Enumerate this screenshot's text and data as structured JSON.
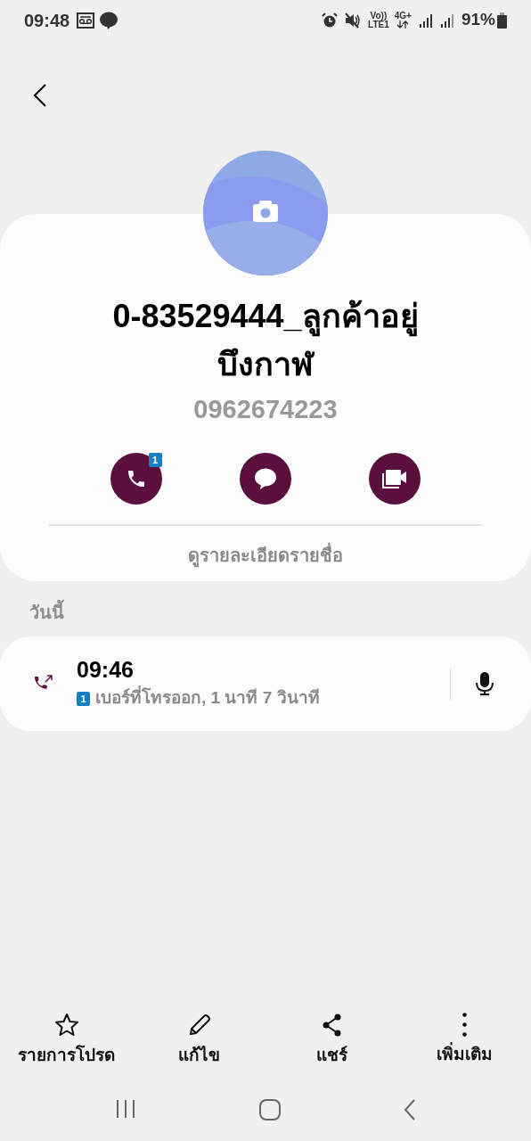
{
  "status_bar": {
    "time": "09:48",
    "volte_top": "Vo))",
    "volte_bottom": "LTE1",
    "network": "4G+",
    "battery": "91%"
  },
  "contact": {
    "name": "0-83529444_ลูกค้าอยู่\nบึงกาฬ",
    "number": "0962674223",
    "call_badge": "1",
    "details_link": "ดูรายละเอียดรายชื่อ"
  },
  "history": {
    "heading": "วันนี้",
    "entries": [
      {
        "time": "09:46",
        "sim": "1",
        "description": "เบอร์ที่โทรออก, 1 นาที 7 วินาที"
      }
    ]
  },
  "bottom_actions": [
    {
      "kind": "favorite",
      "label": "รายการโปรด"
    },
    {
      "kind": "edit",
      "label": "แก้ไข"
    },
    {
      "kind": "share",
      "label": "แชร์"
    },
    {
      "kind": "more",
      "label": "เพิ่มเติม"
    }
  ]
}
